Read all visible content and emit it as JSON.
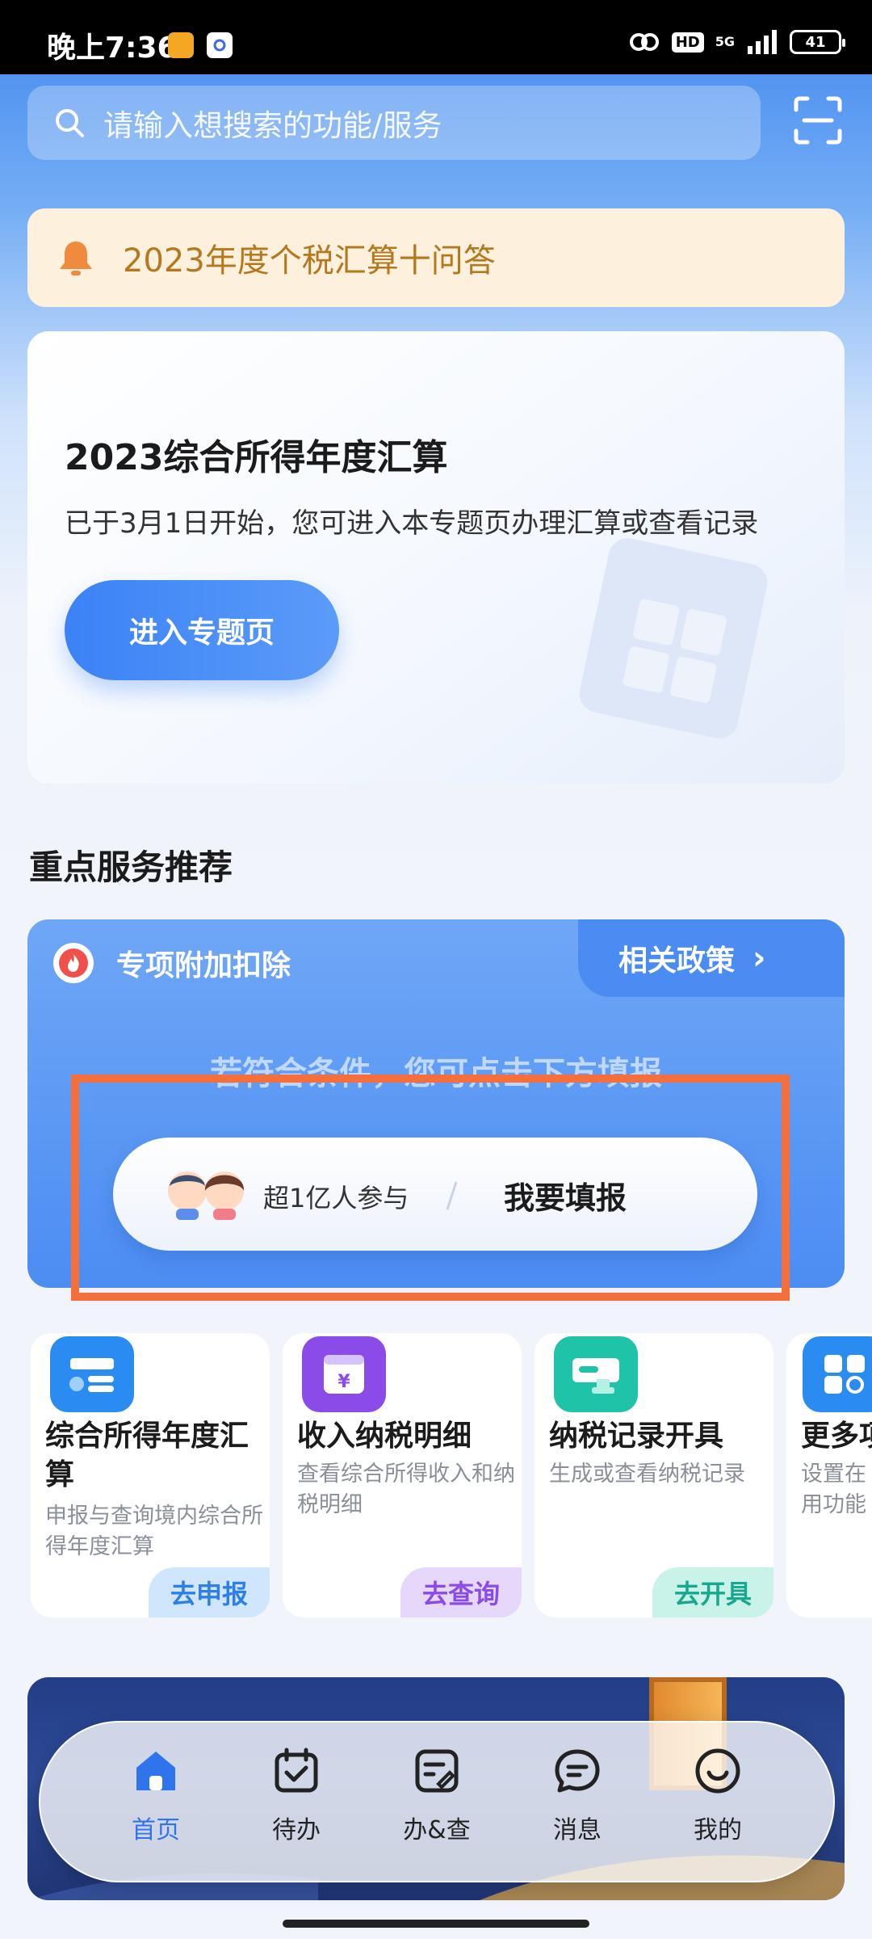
{
  "status_bar": {
    "time": "晚上7:36",
    "hd": "HD",
    "network": "5G",
    "battery": "41"
  },
  "search": {
    "placeholder": "请输入想搜索的功能/服务",
    "icon": "search-icon",
    "scan_icon": "scan-icon"
  },
  "notice": {
    "icon": "bell-icon",
    "text": "2023年度个税汇算十问答"
  },
  "main_card": {
    "title": "2023综合所得年度汇算",
    "description": "已于3月1日开始，您可进入本专题页办理汇算或查看记录",
    "button_label": "进入专题页"
  },
  "section": {
    "title": "重点服务推荐"
  },
  "promo": {
    "tag_icon": "flame-icon",
    "tag": "专项附加扣除",
    "policy_link": "相关政策",
    "hint": "若符合条件，您可点击下方填报",
    "participants": "超1亿人参与",
    "action": "我要填报"
  },
  "tiles": [
    {
      "title": "综合所得年度汇算",
      "description": "申报与查询境内综合所得年度汇算",
      "action": "去申报",
      "icon": "declaration-icon"
    },
    {
      "title": "收入纳税明细",
      "description": "查看综合所得收入和纳税明细",
      "action": "去查询",
      "icon": "income-icon"
    },
    {
      "title": "纳税记录开具",
      "description": "生成或查看纳税记录",
      "action": "去开具",
      "icon": "stamp-icon"
    },
    {
      "title": "更多项",
      "description": "设置在用功能",
      "icon": "grid-icon"
    }
  ],
  "bottom_nav": {
    "items": [
      {
        "label": "首页",
        "icon": "home-icon",
        "active": true
      },
      {
        "label": "待办",
        "icon": "calendar-check-icon"
      },
      {
        "label": "办&查",
        "icon": "edit-doc-icon"
      },
      {
        "label": "消息",
        "icon": "message-icon"
      },
      {
        "label": "我的",
        "icon": "smile-icon"
      }
    ]
  },
  "colors": {
    "brand_blue": "#3b82f6",
    "notice_text": "#b4781d",
    "highlight_orange": "#f46f3c",
    "nav_active": "#2f74ec"
  }
}
